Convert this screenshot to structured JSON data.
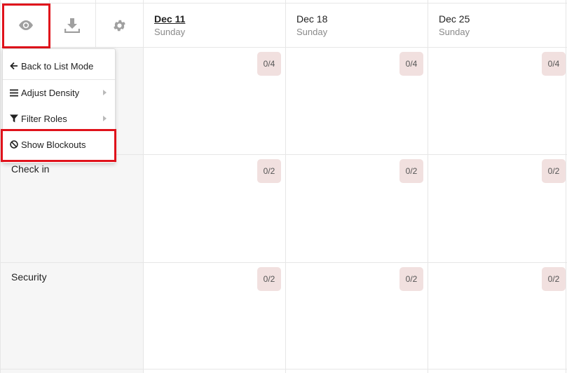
{
  "toolbar": {
    "view_icon": "eye-icon",
    "download_icon": "download-icon",
    "settings_icon": "gear-icon"
  },
  "days": [
    {
      "date": "Dec 11",
      "weekday": "Sunday"
    },
    {
      "date": "Dec 18",
      "weekday": "Sunday"
    },
    {
      "date": "Dec 25",
      "weekday": "Sunday"
    }
  ],
  "roles": [
    {
      "label": "",
      "counts": [
        "0/4",
        "0/4",
        "0/4"
      ]
    },
    {
      "label": "Check in",
      "counts": [
        "0/2",
        "0/2",
        "0/2"
      ]
    },
    {
      "label": "Security",
      "counts": [
        "0/2",
        "0/2",
        "0/2"
      ]
    }
  ],
  "menu": {
    "items": [
      {
        "label": "Back to List Mode",
        "icon": "arrow-left-icon"
      },
      {
        "label": "Adjust Density",
        "icon": "bars-icon"
      },
      {
        "label": "Filter Roles",
        "icon": "filter-icon"
      },
      {
        "label": "Show Blockouts",
        "icon": "ban-icon"
      }
    ]
  },
  "colors": {
    "highlight": "#e0121b",
    "badge_bg": "#f1e0df",
    "sidebar_bg": "#f6f6f6"
  }
}
